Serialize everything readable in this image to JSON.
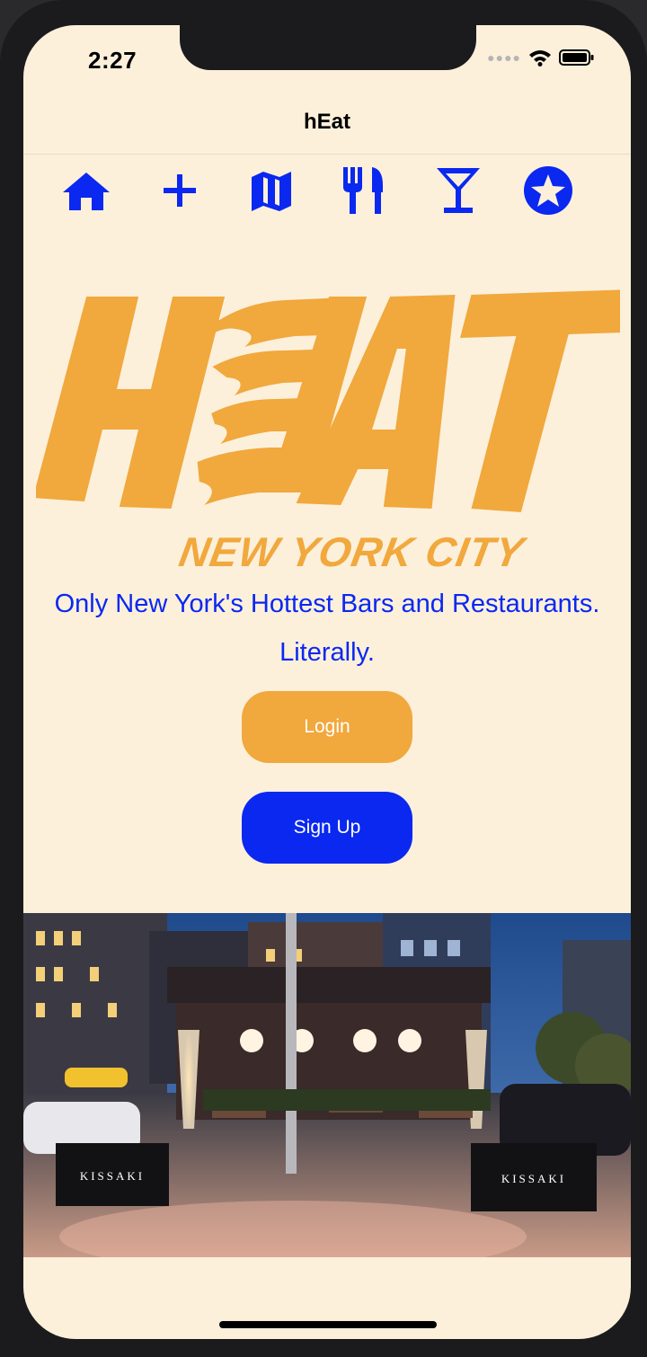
{
  "status_bar": {
    "time": "2:27"
  },
  "nav": {
    "title": "hEat"
  },
  "tabs": [
    {
      "icon": "home-icon"
    },
    {
      "icon": "plus-icon"
    },
    {
      "icon": "map-icon"
    },
    {
      "icon": "fork-knife-icon"
    },
    {
      "icon": "cocktail-icon"
    },
    {
      "icon": "star-icon"
    }
  ],
  "logo": {
    "text": "HEAT",
    "subtitle": "NEW YORK CITY"
  },
  "tagline": {
    "line1": "Only New York's Hottest Bars and Restaurants.",
    "line2": "Literally."
  },
  "buttons": {
    "login": "Login",
    "signup": "Sign Up"
  },
  "photo": {
    "sign_left": "KISSAKI",
    "sign_right": "KISSAKI"
  },
  "colors": {
    "accent_blue": "#0a28f0",
    "accent_orange": "#f1a83c",
    "background": "#fcf0db"
  }
}
